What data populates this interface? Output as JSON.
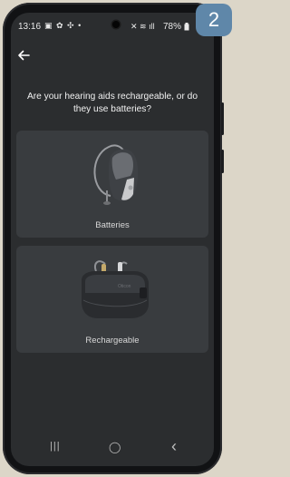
{
  "status_bar": {
    "time": "13:16",
    "left_icons": "▣ ✿ ✣ •",
    "right_icons": "✕ ≋ ıll",
    "battery": "78%"
  },
  "step_badge": "2",
  "header": {
    "question": "Are your hearing aids rechargeable, or do they use batteries?"
  },
  "options": [
    {
      "label": "Batteries",
      "icon": "hearing-aid-icon"
    },
    {
      "label": "Rechargeable",
      "icon": "charger-case-icon"
    }
  ],
  "nav": {
    "recents_glyph": "|||",
    "home_glyph": "◯",
    "back_glyph": "‹"
  }
}
